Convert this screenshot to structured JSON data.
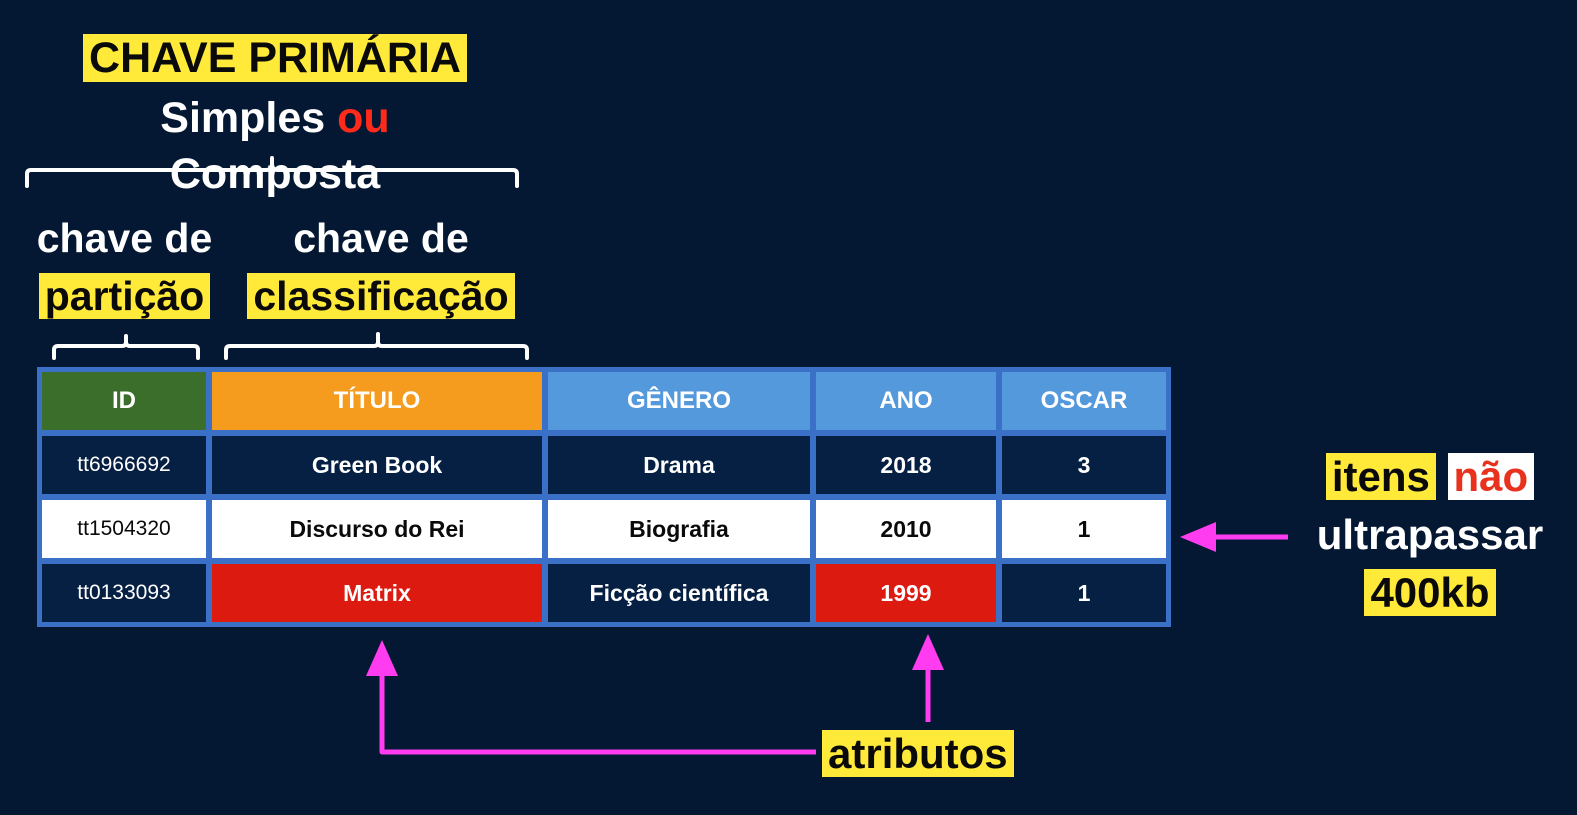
{
  "primary_key": {
    "title": "CHAVE PRIMÁRIA",
    "subtitle_part1": "Simples",
    "subtitle_or": "ou",
    "subtitle_part2": "Composta"
  },
  "partition_key": {
    "line1": "chave de",
    "line2": "partição"
  },
  "sort_key": {
    "line1": "chave de",
    "line2": "classificação"
  },
  "table": {
    "headers": [
      "ID",
      "TÍTULO",
      "GÊNERO",
      "ANO",
      "OSCAR"
    ],
    "rows": [
      [
        "tt6966692",
        "Green Book",
        "Drama",
        "2018",
        "3"
      ],
      [
        "tt1504320",
        "Discurso do Rei",
        "Biografia",
        "2010",
        "1"
      ],
      [
        "tt0133093",
        "Matrix",
        "Ficção científica",
        "1999",
        "1"
      ]
    ]
  },
  "item_note": {
    "word1": "itens",
    "word2": "não",
    "word3": "ultrapassar",
    "word4": "400kb"
  },
  "attributes_label": "atributos",
  "colors": {
    "background": "#041833",
    "highlight_yellow": "#ffea3a",
    "accent_red": "#dd1a10",
    "arrow_magenta": "#ff3cf0",
    "id_header": "#3b6e2a",
    "title_header": "#f59b1d",
    "header_blue": "#5599dd",
    "table_border": "#3a70c6"
  }
}
